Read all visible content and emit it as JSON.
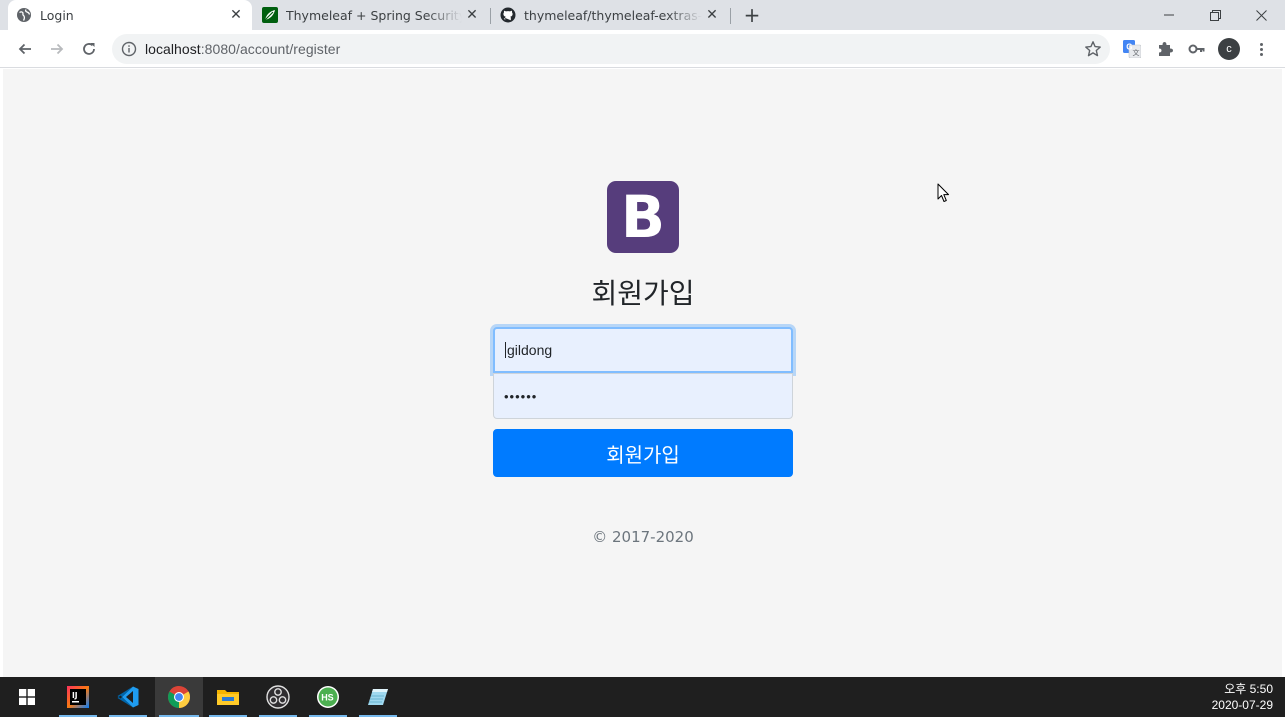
{
  "browser": {
    "tabs": [
      {
        "title": "Login",
        "active": true
      },
      {
        "title": "Thymeleaf + Spring Security integration basics",
        "active": false
      },
      {
        "title": "thymeleaf/thymeleaf-extras-springsecurity",
        "active": false
      }
    ],
    "tab_close_glyph": "✕",
    "new_tab_glyph": "+",
    "url_host": "localhost",
    "url_path": ":8080/account/register",
    "profile_initial": "c"
  },
  "page": {
    "logo_letter": "B",
    "heading": "회원가입",
    "username_value": "gildong",
    "password_value": "••••••",
    "submit_label": "회원가입",
    "copyright": "© 2017-2020"
  },
  "taskbar": {
    "clock_time": "오후 5:50",
    "clock_date": "2020-07-29",
    "apps": [
      "windows-start",
      "intellij",
      "vscode",
      "chrome",
      "file-explorer",
      "obs",
      "heidisql",
      "notepad"
    ]
  },
  "colors": {
    "bootstrap_purple": "#563d7c",
    "primary_blue": "#007bff",
    "autofill_bg": "#e8f0fe",
    "page_bg": "#f5f5f5",
    "taskbar_bg": "#1f1f1f"
  }
}
